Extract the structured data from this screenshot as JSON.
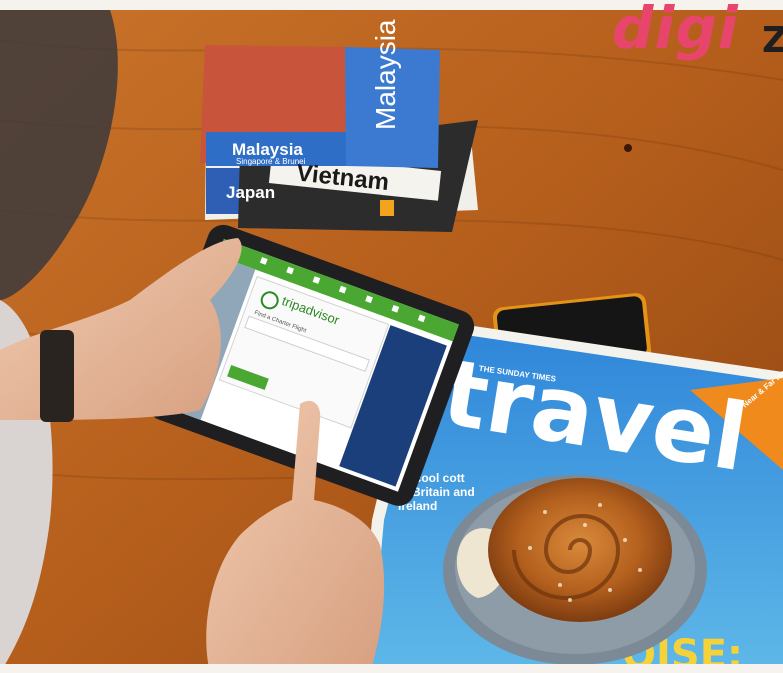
{
  "watermark": {
    "text": "digi",
    "tail": "Z"
  },
  "books": [
    {
      "title": "Malaysia",
      "subtitle": "Singapore & Brunei"
    },
    {
      "title": "Vietnam"
    },
    {
      "title": "Japan"
    }
  ],
  "tablet": {
    "app_name": "tripadvisor",
    "search_placeholder": "Find a Charter Flight"
  },
  "magazine": {
    "masthead": "THE SUNDAY TIMES",
    "title": "travel",
    "cover_line": [
      "30 cool cott",
      "in Britain and",
      "Ireland"
    ],
    "badge": "Near & Far issue",
    "bottom_fragment": "OISE:"
  },
  "colors": {
    "table": "#b5651d",
    "app_green": "#4aa832",
    "magazine_blue": "#1c64c0",
    "logo_pink": "#e8456c",
    "book_blue": "#2f6ec7"
  }
}
